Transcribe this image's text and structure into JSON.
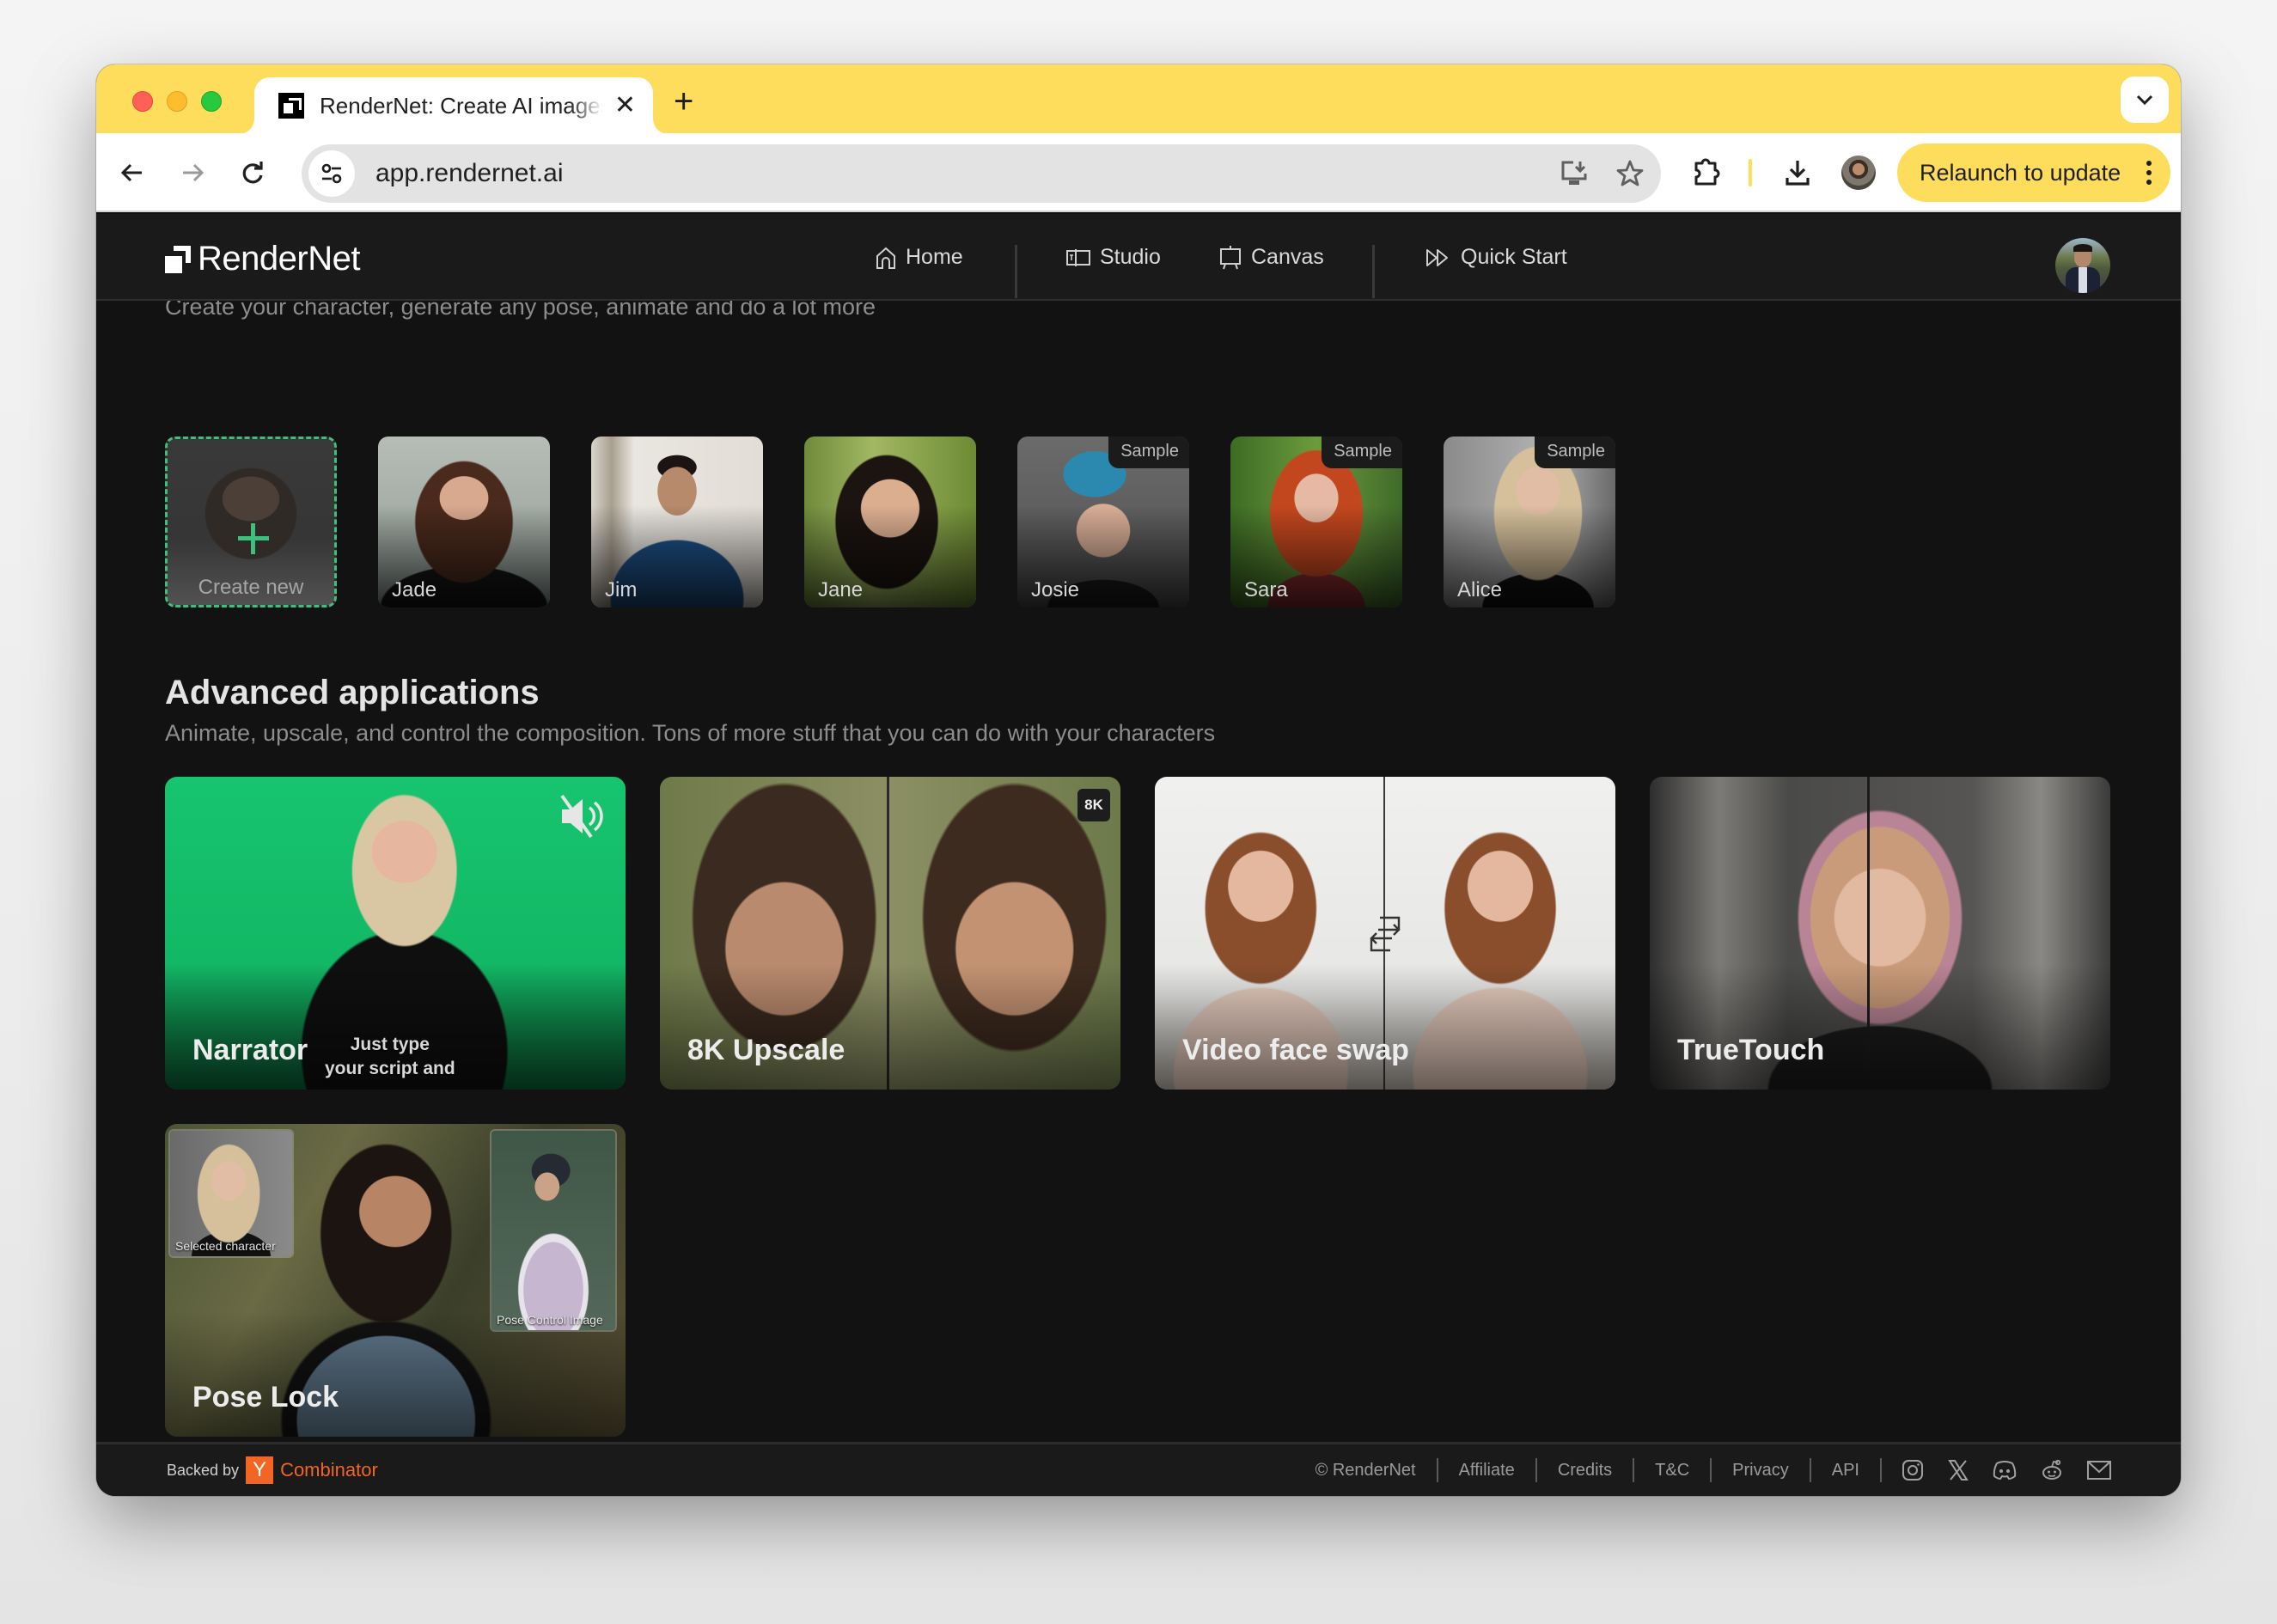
{
  "browser": {
    "tab_title": "RenderNet: Create AI images",
    "url": "app.rendernet.ai",
    "relaunch_label": "Relaunch to update",
    "icons": {
      "back": "arrow-left-icon",
      "forward": "arrow-right-icon",
      "reload": "reload-icon",
      "site_info": "tune-icon",
      "install": "install-app-icon",
      "bookmark": "star-icon",
      "extensions": "puzzle-icon",
      "downloads": "download-icon",
      "profile": "profile-avatar",
      "menu": "kebab-icon",
      "tab_search": "chevron-down-icon"
    },
    "accent_color": "#fedd5c"
  },
  "header": {
    "logo": "RenderNet",
    "nav": [
      {
        "label": "Home",
        "icon": "home-icon"
      },
      {
        "label": "Studio",
        "icon": "studio-icon"
      },
      {
        "label": "Canvas",
        "icon": "canvas-icon"
      },
      {
        "label": "Quick Start",
        "icon": "fast-forward-icon"
      }
    ]
  },
  "characters": {
    "tagline": "Create your character, generate any pose, animate and do a lot more",
    "create_label": "Create new",
    "sample_badge": "Sample",
    "items": [
      {
        "name": "Jade",
        "sample": false
      },
      {
        "name": "Jim",
        "sample": false
      },
      {
        "name": "Jane",
        "sample": false
      },
      {
        "name": "Josie",
        "sample": true
      },
      {
        "name": "Sara",
        "sample": true
      },
      {
        "name": "Alice",
        "sample": true
      }
    ],
    "create_color": "#3fbf7f"
  },
  "advanced": {
    "title": "Advanced applications",
    "subtitle": "Animate, upscale, and control the composition. Tons of more stuff that you can do with your characters",
    "apps": [
      {
        "title": "Narrator",
        "caption_line1": "Just type",
        "caption_line2": "your script and",
        "icon": "mute-icon"
      },
      {
        "title": "8K Upscale",
        "badge": "8K"
      },
      {
        "title": "Video face swap",
        "icon": "swap-icon"
      },
      {
        "title": "TrueTouch"
      },
      {
        "title": "Pose Lock",
        "inset_left": "Selected character",
        "inset_right": "Pose Control Image"
      }
    ]
  },
  "footer": {
    "backed_by": "Backed by",
    "yc_letter": "Y",
    "yc_name": "Combinator",
    "links": [
      "© RenderNet",
      "Affiliate",
      "Credits",
      "T&C",
      "Privacy",
      "API"
    ],
    "social": [
      "instagram-icon",
      "x-icon",
      "discord-icon",
      "reddit-icon",
      "mail-icon"
    ],
    "yc_color": "#f26522"
  }
}
